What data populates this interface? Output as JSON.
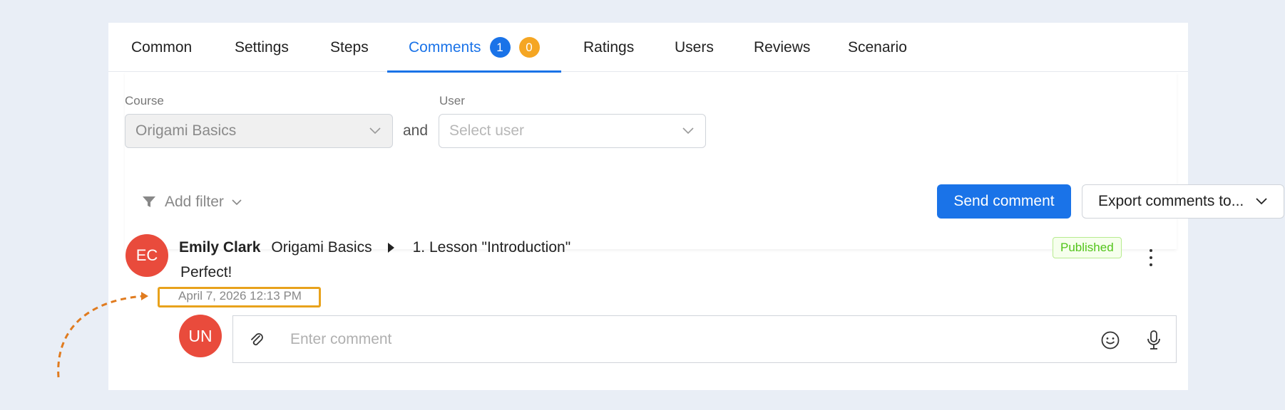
{
  "tabs": [
    {
      "label": "Common"
    },
    {
      "label": "Settings"
    },
    {
      "label": "Steps"
    },
    {
      "label": "Comments",
      "badge_blue": "1",
      "badge_orange": "0"
    },
    {
      "label": "Ratings"
    },
    {
      "label": "Users"
    },
    {
      "label": "Reviews"
    },
    {
      "label": "Scenario"
    }
  ],
  "filters": {
    "course_label": "Course",
    "course_value": "Origami Basics",
    "and_text": "and",
    "user_label": "User",
    "user_placeholder": "Select user",
    "add_filter": "Add filter",
    "send_comment": "Send comment",
    "export_label": "Export comments to..."
  },
  "comment": {
    "avatar_initials": "EC",
    "author": "Emily Clark",
    "course": "Origami Basics",
    "lesson": "1. Lesson \"Introduction\"",
    "text": "Perfect!",
    "date": "April 7, 2026 12:13 PM",
    "status": "Published"
  },
  "reply": {
    "avatar_initials": "UN",
    "placeholder": "Enter comment"
  },
  "colors": {
    "accent": "#1a73e8",
    "badge_orange": "#f5a623",
    "avatar": "#e94b3c",
    "status_green": "#52c41a",
    "highlight": "#e8a21c"
  },
  "icons": {
    "filter": "funnel-icon",
    "chevron": "chevron-down-icon",
    "attach": "paperclip-icon",
    "emoji": "smile-icon",
    "mic": "microphone-icon",
    "more": "more-vertical-icon"
  }
}
